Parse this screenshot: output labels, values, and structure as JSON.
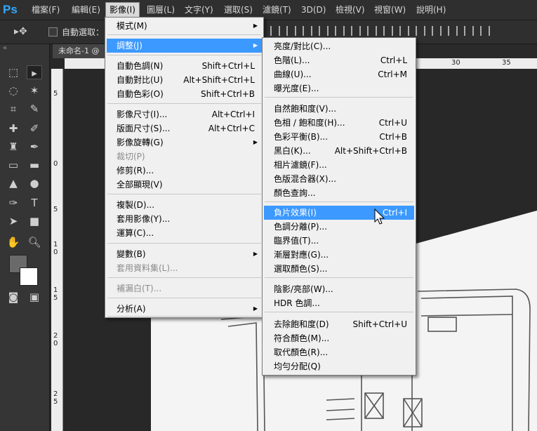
{
  "app": {
    "logo": "Ps",
    "menu": [
      "檔案(F)",
      "編輯(E)",
      "影像(I)",
      "圖層(L)",
      "文字(Y)",
      "選取(S)",
      "濾鏡(T)",
      "3D(D)",
      "檢視(V)",
      "視窗(W)",
      "說明(H)"
    ],
    "active_menu": "影像(I)"
  },
  "options_bar": {
    "move_tool_icon": "move-icon",
    "auto_select_label": "自動選取：",
    "auto_select_checked": false
  },
  "document": {
    "tab_title": "未命名-1 @"
  },
  "rulers": {
    "top_labels": [
      "30",
      "35"
    ],
    "left_labels": [
      "5",
      "0",
      "5",
      "1",
      "0",
      "1",
      "5",
      "2",
      "0",
      "2",
      "5"
    ]
  },
  "image_menu": {
    "items": [
      {
        "label": "模式(M)",
        "shortcut": "",
        "submenu": true
      },
      {
        "label": "調整(J)",
        "shortcut": "",
        "submenu": true,
        "highlight": true
      },
      {
        "label": "自動色調(N)",
        "shortcut": "Shift+Ctrl+L"
      },
      {
        "label": "自動對比(U)",
        "shortcut": "Alt+Shift+Ctrl+L"
      },
      {
        "label": "自動色彩(O)",
        "shortcut": "Shift+Ctrl+B"
      },
      {
        "label": "影像尺寸(I)...",
        "shortcut": "Alt+Ctrl+I"
      },
      {
        "label": "版面尺寸(S)...",
        "shortcut": "Alt+Ctrl+C"
      },
      {
        "label": "影像旋轉(G)",
        "shortcut": "",
        "submenu": true
      },
      {
        "label": "裁切(P)",
        "shortcut": "",
        "disabled": true
      },
      {
        "label": "修剪(R)...",
        "shortcut": ""
      },
      {
        "label": "全部顯現(V)",
        "shortcut": ""
      },
      {
        "label": "複製(D)...",
        "shortcut": ""
      },
      {
        "label": "套用影像(Y)...",
        "shortcut": ""
      },
      {
        "label": "運算(C)...",
        "shortcut": ""
      },
      {
        "label": "變數(B)",
        "shortcut": "",
        "submenu": true
      },
      {
        "label": "套用資料集(L)...",
        "shortcut": "",
        "disabled": true
      },
      {
        "label": "補漏白(T)...",
        "shortcut": "",
        "disabled": true
      },
      {
        "label": "分析(A)",
        "shortcut": "",
        "submenu": true
      }
    ]
  },
  "adjust_menu": {
    "items": [
      {
        "label": "亮度/對比(C)...",
        "shortcut": ""
      },
      {
        "label": "色階(L)...",
        "shortcut": "Ctrl+L"
      },
      {
        "label": "曲線(U)...",
        "shortcut": "Ctrl+M"
      },
      {
        "label": "曝光度(E)...",
        "shortcut": ""
      },
      {
        "label": "自然飽和度(V)...",
        "shortcut": ""
      },
      {
        "label": "色相 / 飽和度(H)...",
        "shortcut": "Ctrl+U"
      },
      {
        "label": "色彩平衡(B)...",
        "shortcut": "Ctrl+B"
      },
      {
        "label": "黑白(K)...",
        "shortcut": "Alt+Shift+Ctrl+B"
      },
      {
        "label": "相片濾鏡(F)...",
        "shortcut": ""
      },
      {
        "label": "色版混合器(X)...",
        "shortcut": ""
      },
      {
        "label": "顏色查詢...",
        "shortcut": ""
      },
      {
        "label": "負片效果(I)",
        "shortcut": "Ctrl+I",
        "highlight": true
      },
      {
        "label": "色調分離(P)...",
        "shortcut": ""
      },
      {
        "label": "臨界值(T)...",
        "shortcut": ""
      },
      {
        "label": "漸層對應(G)...",
        "shortcut": ""
      },
      {
        "label": "選取顏色(S)...",
        "shortcut": ""
      },
      {
        "label": "陰影/亮部(W)...",
        "shortcut": ""
      },
      {
        "label": "HDR 色調...",
        "shortcut": ""
      },
      {
        "label": "去除飽和度(D)",
        "shortcut": "Shift+Ctrl+U"
      },
      {
        "label": "符合顏色(M)...",
        "shortcut": ""
      },
      {
        "label": "取代顏色(R)...",
        "shortcut": ""
      },
      {
        "label": "均勻分配(Q)",
        "shortcut": ""
      }
    ]
  },
  "colors": {
    "highlight": "#3c99ff",
    "foreground": "#6a6a6a",
    "background": "#ffffff"
  }
}
